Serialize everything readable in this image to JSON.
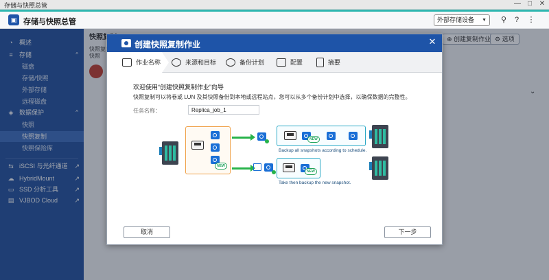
{
  "window": {
    "title": "存储与快照总管",
    "controls": [
      "—",
      "□",
      "✕"
    ]
  },
  "app": {
    "title": "存储与快照总管",
    "external_device": "外部存储设备",
    "header_icons": [
      "search-icon",
      "help-icon",
      "more-icon"
    ]
  },
  "sidebar": {
    "items": [
      {
        "label": "概述",
        "icon": "dashboard-icon"
      },
      {
        "label": "存储",
        "icon": "storage-icon"
      }
    ],
    "storage_sub": [
      "磁盘",
      "存储/快照",
      "外部存储",
      "远程磁盘"
    ],
    "protection": {
      "label": "数据保护",
      "icon": "shield-icon"
    },
    "protection_sub": [
      "快照",
      "快照复制",
      "快照保险库"
    ],
    "bottom": [
      {
        "label": "iSCSI 与光纤通道",
        "icon": "iscsi-icon"
      },
      {
        "label": "HybridMount",
        "icon": "hybridmount-icon"
      },
      {
        "label": "SSD 分析工具",
        "icon": "ssd-icon"
      },
      {
        "label": "VJBOD Cloud",
        "icon": "cloud-icon"
      }
    ]
  },
  "background": {
    "page_title": "快照复制",
    "create_button": "创建复制作业",
    "options_button": "选项",
    "tab1": "快照复制",
    "tab2": "快照"
  },
  "dialog": {
    "title": "创建快照复制作业",
    "steps": [
      "作业名称",
      "来源和目标",
      "备份计划",
      "配置",
      "摘要"
    ],
    "welcome": "欢迎使用“创建快照复制作业”向导",
    "description": "快照复制可以将卷或 LUN 及其快照备份到本地或远程站点，您可以从多个备份计划中选择，以确保数据的完整性。",
    "task_name_label": "任务名称：",
    "task_name_value": "Replica_job_1",
    "diagram": {
      "caption_top": "Backup all snapshots according to schedule.",
      "caption_bottom": "Take then backup the new snapshot.",
      "new_badge": "NEW"
    },
    "cancel": "取消",
    "next": "下一步"
  }
}
